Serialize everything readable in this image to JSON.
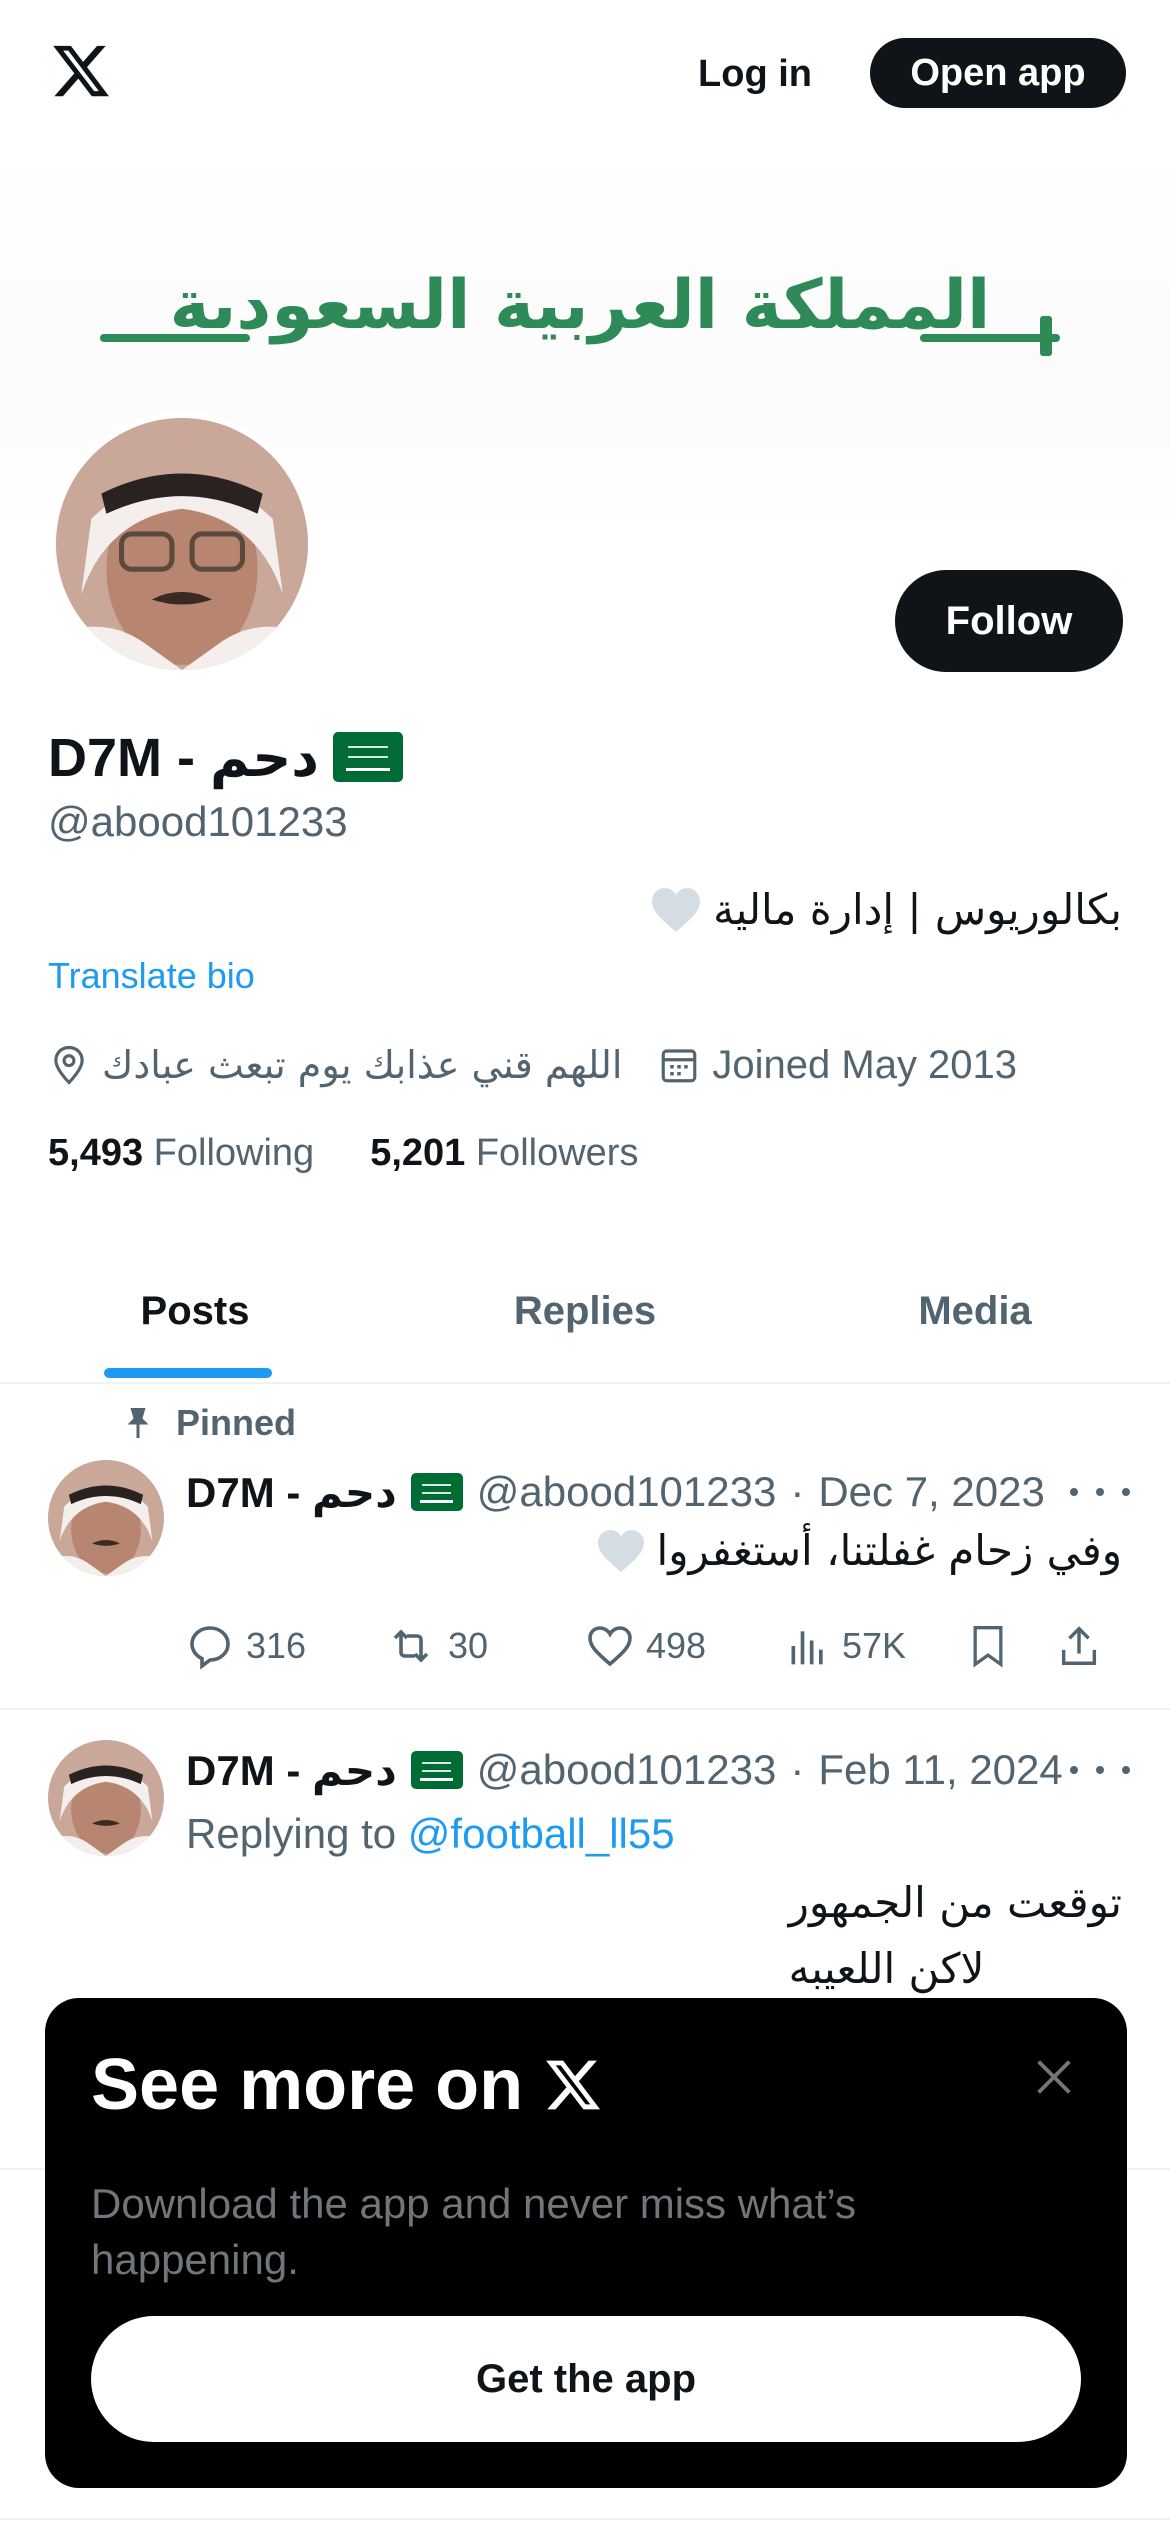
{
  "header": {
    "login_label": "Log in",
    "open_app_label": "Open app"
  },
  "banner": {
    "text": "المملكة العربية السعودية"
  },
  "profile": {
    "follow_label": "Follow",
    "display_name": "D7M - دحم",
    "handle": "@abood101233",
    "bio": "بكالوريوس | إدارة مالية",
    "translate_label": "Translate bio",
    "location": "اللهم قني عذابك يوم تبعث عبادك",
    "joined": "Joined May 2013",
    "following_count": "5,493",
    "following_label": "Following",
    "followers_count": "5,201",
    "followers_label": "Followers"
  },
  "tabs": [
    {
      "label": "Posts",
      "active": true
    },
    {
      "label": "Replies",
      "active": false
    },
    {
      "label": "Media",
      "active": false
    }
  ],
  "posts": [
    {
      "pinned_label": "Pinned",
      "name": "D7M - دحم",
      "handle": "@abood101233",
      "date": "Dec 7, 2023",
      "separator": "·",
      "text": "وفي زحام غفلتنا، أستغفروا",
      "replies": "316",
      "reposts": "30",
      "likes": "498",
      "views": "57K"
    },
    {
      "name": "D7M - دحم",
      "handle": "@abood101233",
      "date": "Feb 11, 2024",
      "separator": "·",
      "replying_prefix": "Replying to",
      "replying_to": "@football_ll55",
      "text_line1": "توقعت من الجمهور",
      "text_line2": "لاكن اللعيبه"
    }
  ],
  "promo": {
    "title": "See more on",
    "subtitle": "Download the app and never miss what’s happening.",
    "button_label": "Get the app"
  },
  "colors": {
    "accent": "#1d9bf0",
    "text_primary": "#0f1419",
    "text_secondary": "#536471",
    "banner_green": "#2e8a57"
  }
}
